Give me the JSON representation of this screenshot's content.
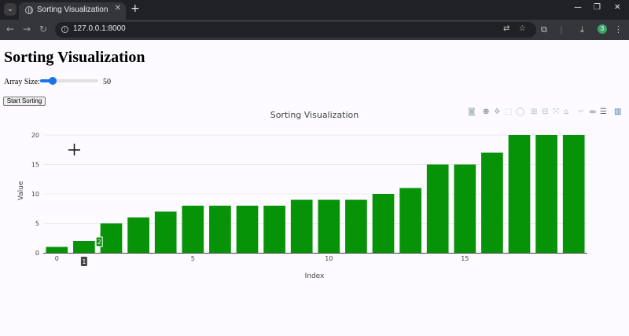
{
  "browser": {
    "tab_title": "Sorting Visualization",
    "url": "127.0.0.1:8000",
    "profile_initial": "3"
  },
  "page": {
    "title": "Sorting Visualization",
    "array_size_label": "Array Size:",
    "array_size_value": "50",
    "array_size_fraction": 0.22,
    "start_button": "Start Sorting"
  },
  "chart_data": {
    "type": "bar",
    "title": "Sorting Visualization",
    "xlabel": "Index",
    "ylabel": "Value",
    "x": [
      0,
      1,
      2,
      3,
      4,
      5,
      6,
      7,
      8,
      9,
      10,
      11,
      12,
      13,
      14,
      15,
      16,
      17,
      18,
      19
    ],
    "values": [
      1,
      2,
      5,
      6,
      7,
      8,
      8,
      8,
      8,
      9,
      9,
      9,
      10,
      11,
      15,
      15,
      17,
      20,
      20,
      20
    ],
    "xticks": [
      0,
      5,
      10,
      15
    ],
    "yticks": [
      0,
      5,
      10,
      15,
      20
    ],
    "xlim": [
      -0.5,
      19.5
    ],
    "ylim": [
      0,
      20
    ],
    "grid": true,
    "bar_color": "#079307",
    "annotations": [
      {
        "text": "2",
        "x": 1.5,
        "y": 2,
        "kind": "value-marker"
      },
      {
        "text": "1",
        "x": 1,
        "y": 0,
        "kind": "index-marker"
      }
    ]
  },
  "colors": {
    "accent": "#1a73e8",
    "bar": "#079307",
    "chrome_dark": "#202124"
  }
}
